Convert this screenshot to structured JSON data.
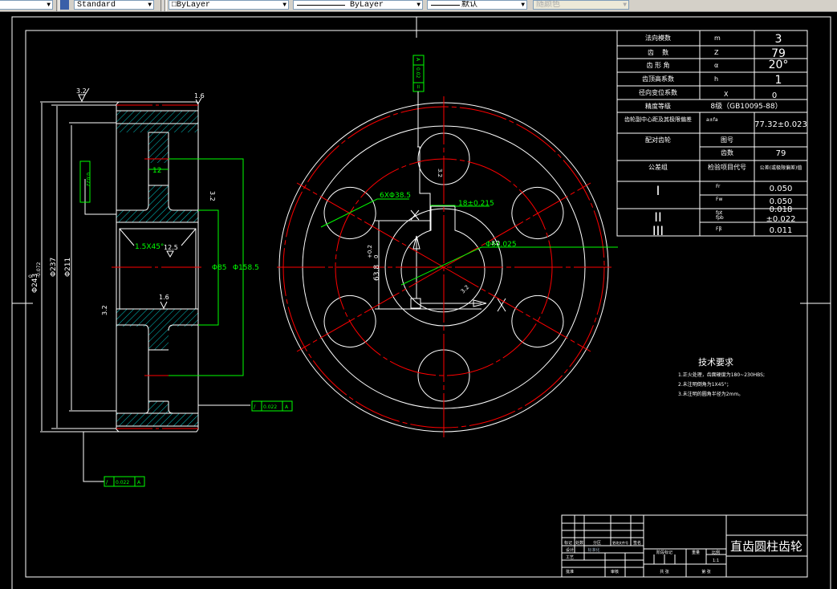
{
  "toolbar": {
    "textstyle": "Standard",
    "layer_color": "ByLayer",
    "linetype": "ByLayer",
    "lineweight": "默认",
    "plotstyle": "随颜色"
  },
  "colors": {
    "background": "#000000",
    "lines": "#ffffff",
    "dimension": "#00ff00",
    "centerline": "#ff0000",
    "hatch": "#00ffff"
  },
  "side_view": {
    "dims": [
      "Φ243",
      "0",
      "-0.072",
      "Φ237",
      "Φ211",
      "12",
      "Φ85",
      "Φ158.5",
      "1.5X45°"
    ],
    "roughness": [
      "3.2",
      "1.6",
      "3.2",
      "12.5",
      "1.6",
      "3.2"
    ],
    "tolerances": [
      {
        "symbol": "/",
        "value": "0.022",
        "datum": "A"
      },
      {
        "symbol": "/",
        "value": "0.022",
        "datum": "A"
      },
      {
        "symbol": "/",
        "value": "0.022",
        "datum": "A"
      }
    ]
  },
  "front_view": {
    "holes_label": "6XΦ38.5",
    "keyway_width": "18±0.215",
    "bore": "Φ60.025",
    "keyway_depth": "63.8",
    "keyway_tol_up": "+0.2",
    "keyway_tol_low": "0",
    "symmetry_tol": {
      "symbol": "=",
      "value": "0.02",
      "datum": "A"
    },
    "roughness": [
      "3.2",
      "3.2",
      "3.2"
    ]
  },
  "params_table": {
    "rows": [
      {
        "label": "法向模数",
        "symbol": "m",
        "value": "3"
      },
      {
        "label": "齿    数",
        "symbol": "Z",
        "value": "79"
      },
      {
        "label": "齿 形 角",
        "symbol": "α",
        "value": "20°"
      },
      {
        "label": "齿顶高系数",
        "symbol": "h",
        "value": "1"
      },
      {
        "label": "径向变位系数",
        "symbol": "X",
        "value": "0"
      }
    ],
    "accuracy_label": "精度等级",
    "accuracy_value": "8级（GB10095-88）",
    "center_label": "齿轮副中心距及其极限偏差",
    "center_symbol": "a±fa",
    "center_value": "77.32±0.023",
    "mating_label": "配对齿轮",
    "drawing_no_label": "图号",
    "drawing_no_value": "",
    "teeth_label": "齿数",
    "teeth_value": "79",
    "group_label": "公差组",
    "item_label": "检验项目代号",
    "tol_label": "公差(或极限偏差)值",
    "groups": [
      {
        "name": "I",
        "items": [
          {
            "code": "Fr",
            "value": "0.050"
          },
          {
            "code": "Fw",
            "value": "0.050"
          }
        ]
      },
      {
        "name": "II",
        "items": [
          {
            "code": "fpt",
            "value": "0.018"
          },
          {
            "code": "fpb",
            "value": "±0.022"
          }
        ]
      },
      {
        "name": "III",
        "items": [
          {
            "code": "Fβ",
            "value": "0.011"
          }
        ]
      }
    ]
  },
  "tech_req": {
    "title": "技术要求",
    "items": [
      "1.正火处理，齿面硬度为180~230HBS;",
      "2.未注明倒角为1X45°；",
      "3.未注明的圆角半径为2mm。"
    ]
  },
  "title_block": {
    "name": "直齿圆柱齿轮",
    "cells": [
      "标记",
      "处数",
      "分区",
      "更改文件号",
      "签名",
      "设计",
      "标准化",
      "阶段标记",
      "重量",
      "比例",
      "1:1",
      "审核",
      "工艺",
      "批准",
      "共 张",
      "第 张"
    ]
  }
}
